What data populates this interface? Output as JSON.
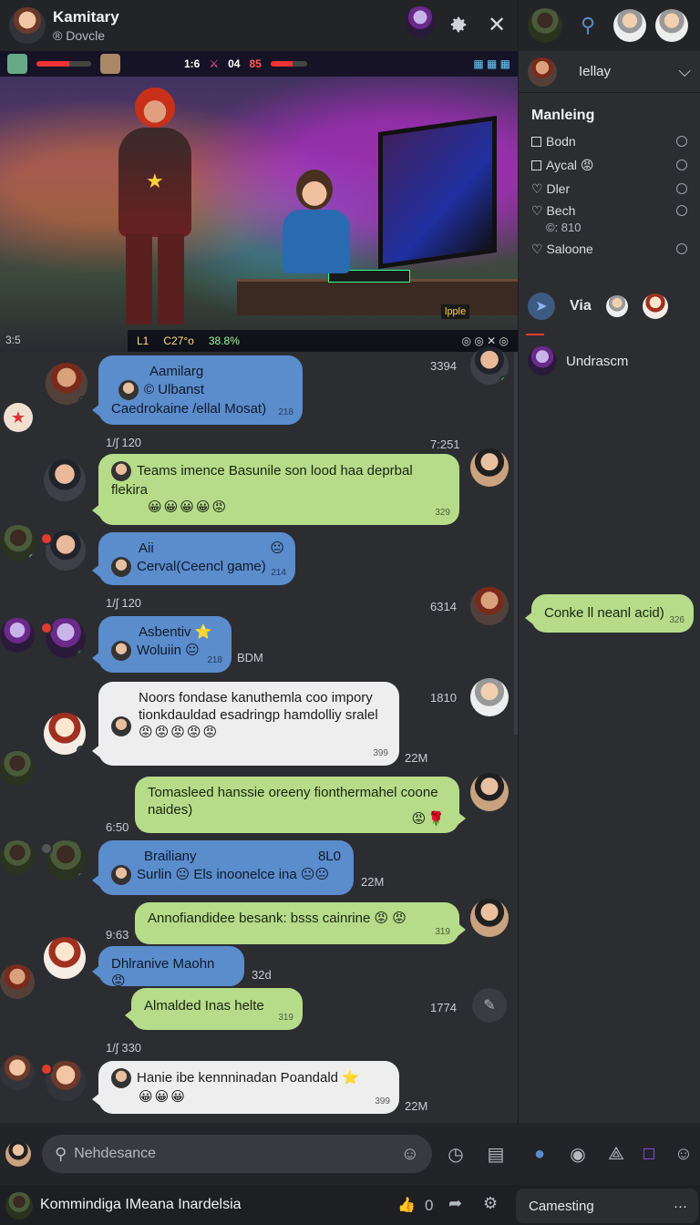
{
  "header": {
    "title": "Kamitary",
    "subtitle": "® Dovcle"
  },
  "stream": {
    "hud_top": [
      "1:6",
      "04",
      "85"
    ],
    "hud_bottom": [
      "L1",
      "C27°o",
      "38.8%"
    ],
    "hud_left": "3:5",
    "badge": "lpple"
  },
  "chat": {
    "msg1": {
      "name": "Aamilarg",
      "sub": "© Ulbanst",
      "text": "Caedrokaine /ellal Mosat)",
      "stamp": "218",
      "time": "3394"
    },
    "sep1": {
      "left": "1/ʃ 120",
      "right": "7:251"
    },
    "msg2": {
      "text": "Teams imence Basunile son lood haa deprbal flekira",
      "emoji": "😀😀😀😀😡",
      "stamp": "329"
    },
    "msg3": {
      "name": "Aii",
      "text": "Cerval(Ceencl game)",
      "stamp": "214"
    },
    "sep2": {
      "left": "1/ʃ 120",
      "right": "6314"
    },
    "msg4": {
      "name": "Asbentiv ⭐",
      "text": "Woluiin 😐",
      "stamp": "218",
      "time": "BDM"
    },
    "msg5": {
      "text": "Noors fondase kanuthemla coo impory tionkdauldad esadringp hamdolliy sralel",
      "emoji": "😡😡😡😡😡",
      "stamp": "399",
      "time_top": "1810",
      "time_bot": "22M"
    },
    "msg6": {
      "text": "Tomasleed hanssie oreeny fionthermahel coone naides)",
      "emoji": "😡🌹",
      "time": "6:50"
    },
    "msg7": {
      "name": "Brailiany",
      "side": "8L0",
      "text": "Surlin 😐 Els inoonelce ina 😐😐",
      "time": "22M"
    },
    "msg8": {
      "text": "Annofiandidee besank: bsss cainrine 😡 😡",
      "stamp": "319",
      "time": "9:63"
    },
    "msg9": {
      "text": "Dhlranive Maohn 😡",
      "time": "32d"
    },
    "msg10": {
      "text": "Almalded Inas helte",
      "stamp": "319",
      "time": "1774"
    },
    "sep3": {
      "left": "1/ʃ 330"
    },
    "msg11": {
      "text": "Hanie ibe kennninadan Poandald ⭐",
      "emoji": "😀😀😀",
      "stamp": "399",
      "time": "22M"
    },
    "right_msg": {
      "text": "Conke ll neanl acid)",
      "stamp": "326"
    }
  },
  "composer": {
    "placeholder": "Nehdesance"
  },
  "footer": {
    "name": "Kommindiga IMeana Inardelsia",
    "count": "0",
    "channel": "Camesting",
    "more": "···"
  },
  "right_panel": {
    "user": "Iellay",
    "section_title": "Manleing",
    "members": [
      {
        "label": "Bodn",
        "extra": ""
      },
      {
        "label": "Aycal",
        "extra": ""
      },
      {
        "label": "Dler",
        "extra": ""
      },
      {
        "label": "Bech",
        "extra": "©: 810"
      },
      {
        "label": "Saloone",
        "extra": ""
      }
    ],
    "tab": "Via",
    "list_user": "Undrascm"
  }
}
